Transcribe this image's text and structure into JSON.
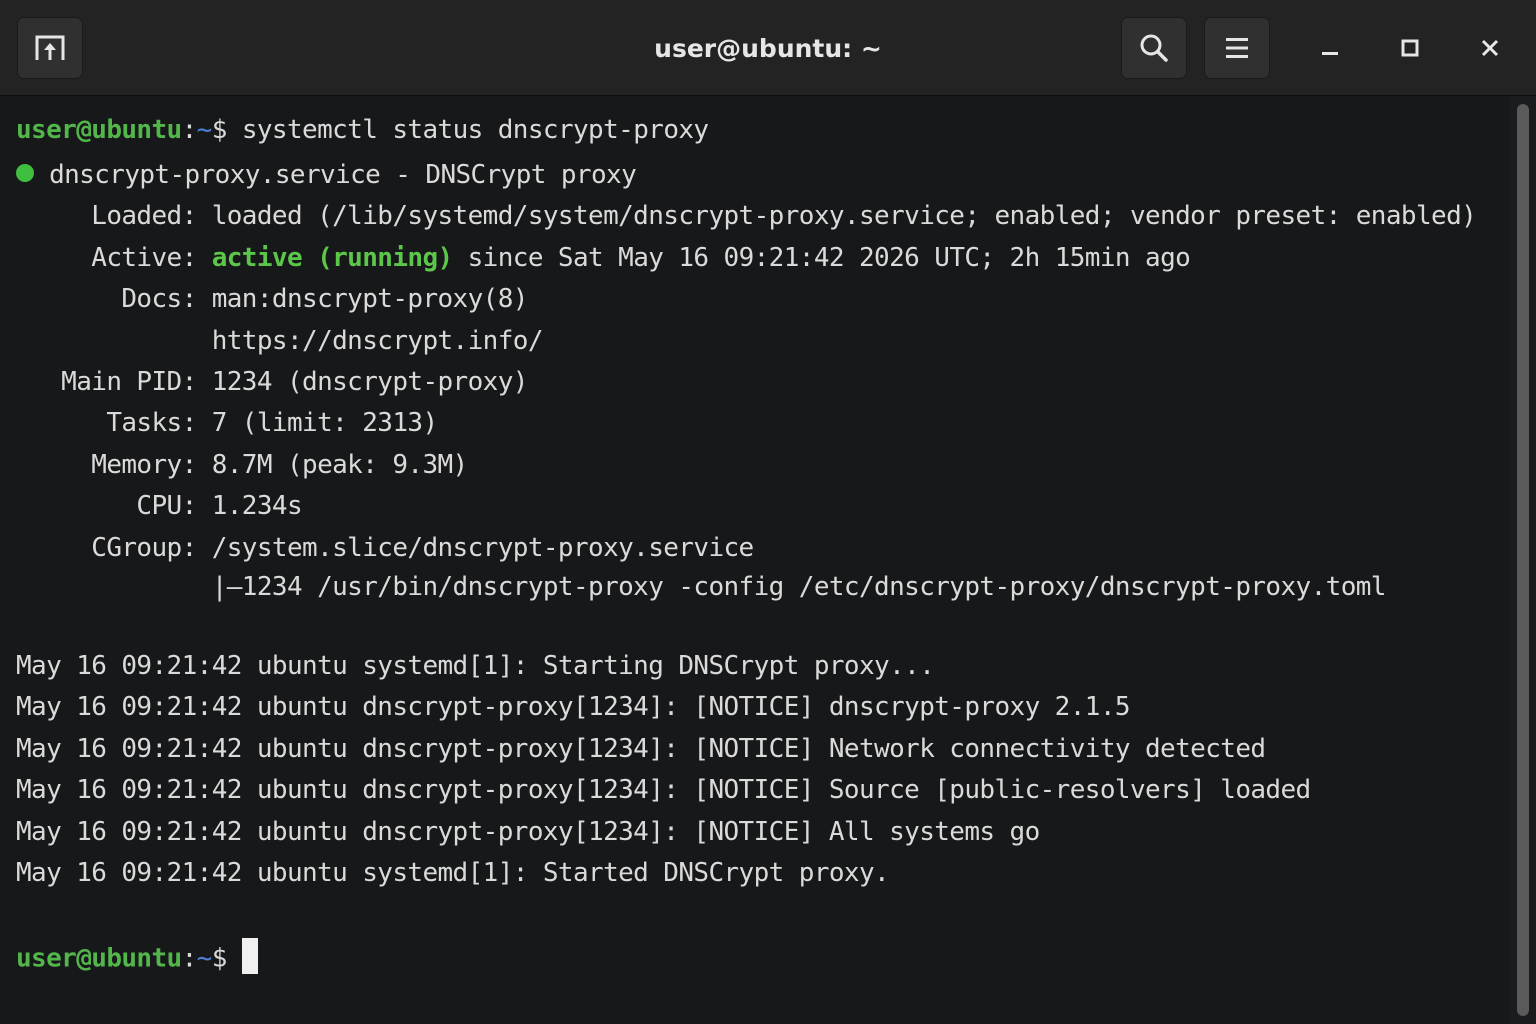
{
  "window": {
    "title": "user@ubuntu: ~"
  },
  "titlebar_icons": {
    "new_tab": "new-tab-icon",
    "search": "search-icon",
    "menu": "hamburger-menu-icon",
    "minimize": "minimize-icon",
    "maximize": "maximize-icon",
    "close": "close-icon"
  },
  "prompt": {
    "userhost": "user@ubuntu",
    "colon": ":",
    "path": "~",
    "dollar": "$ "
  },
  "command": "systemctl status dnscrypt-proxy",
  "status": {
    "service_line": "dnscrypt-proxy.service - DNSCrypt proxy",
    "loaded": "     Loaded: loaded (/lib/systemd/system/dnscrypt-proxy.service; enabled; vendor preset: enabled)",
    "active_label": "     Active: ",
    "active_state": "active (running)",
    "active_rest": " since Sat May 16 09:21:42 2026 UTC; 2h 15min ago",
    "docs": "       Docs: man:dnscrypt-proxy(8)",
    "docs2": "             https://dnscrypt.info/",
    "main_pid": "   Main PID: 1234 (dnscrypt-proxy)",
    "tasks": "      Tasks: 7 (limit: 2313)",
    "memory": "     Memory: 8.7M (peak: 9.3M)",
    "cpu": "        CPU: 1.234s",
    "cgroup": "     CGroup: /system.slice/dnscrypt-proxy.service",
    "cgroup_child": "             |—1234 /usr/bin/dnscrypt-proxy -config /etc/dnscrypt-proxy/dnscrypt-proxy.toml"
  },
  "logs": [
    "May 16 09:21:42 ubuntu systemd[1]: Starting DNSCrypt proxy...",
    "May 16 09:21:42 ubuntu dnscrypt-proxy[1234]: [NOTICE] dnscrypt-proxy 2.1.5",
    "May 16 09:21:42 ubuntu dnscrypt-proxy[1234]: [NOTICE] Network connectivity detected",
    "May 16 09:21:42 ubuntu dnscrypt-proxy[1234]: [NOTICE] Source [public-resolvers] loaded",
    "May 16 09:21:42 ubuntu dnscrypt-proxy[1234]: [NOTICE] All systems go",
    "May 16 09:21:42 ubuntu systemd[1]: Started DNSCrypt proxy."
  ],
  "colors": {
    "prompt_green": "#52b64a",
    "path_blue": "#4c7fd6",
    "status_dot": "#3fbf3f",
    "background": "#171819"
  }
}
